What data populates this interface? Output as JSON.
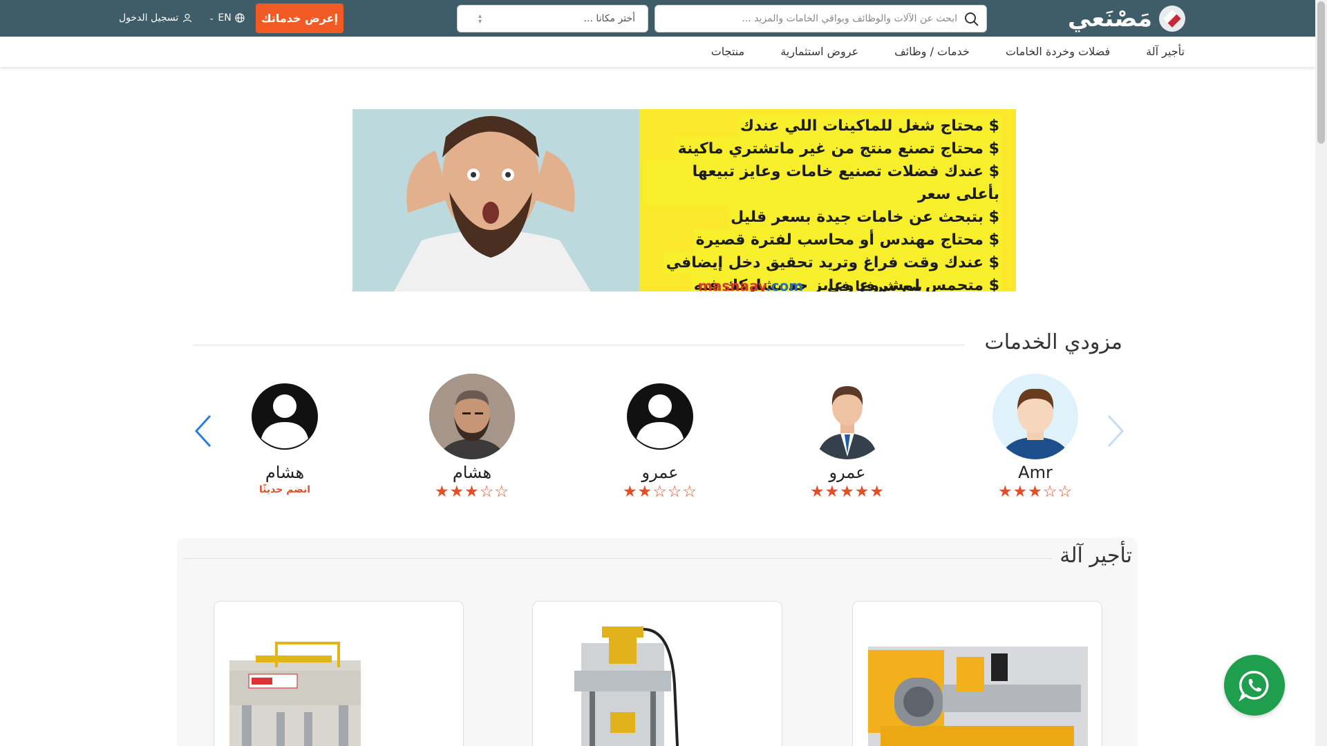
{
  "header": {
    "logo_text": "مَصْنَعي",
    "search_placeholder": "ابحث عن الآلات والوظائف وبواقي الخامات والمزيد ...",
    "place_placeholder": "أختر مكانا ...",
    "cta_label": "إعرض خدماتك",
    "lang_label": "EN",
    "login_label": "تسجيل الدخول"
  },
  "nav": {
    "items": [
      "تأجير آلة",
      "فضلات وخردة الخامات",
      "خدمات / وظائف",
      "عروض استثمارية",
      "منتجات"
    ]
  },
  "banner": {
    "lines": [
      "$ محتاج شغل للماكينات اللي عندك",
      "$ محتاج تصنع منتج من غير ماتشتري ماكينة",
      "$ عندك فضلات تصنيع خامات وعايز تبيعها بأعلى سعر",
      "$ بتبحث عن خامات جيدة بسعر قليل",
      "$ محتاج مهندس أو محاسب لفترة قصيرة",
      "$ عندك وقت فراغ وتريد تحقيق دخل إيضافي",
      "$ متحمس لمشروع وعايز حد يشاركك فيه"
    ],
    "url_prefix": "masnaay",
    "url_suffix": ".com",
    "url_trailing": "بيع شرفنا في"
  },
  "providers": {
    "title": "مزودي الخدمات",
    "items": [
      {
        "name": "Amr",
        "stars": "★★★☆☆",
        "rating": 3,
        "avatar": "cartoon-man"
      },
      {
        "name": "عمرو",
        "stars": "★★★★★",
        "rating": 5,
        "avatar": "businessman"
      },
      {
        "name": "عمرو",
        "stars": "★★☆☆☆",
        "rating": 2,
        "avatar": "default"
      },
      {
        "name": "هشام",
        "stars": "★★★☆☆",
        "rating": 3,
        "avatar": "photo"
      },
      {
        "name": "هشام",
        "newtag": "انضم حديثًا",
        "avatar": "default"
      }
    ]
  },
  "rentals": {
    "title": "تأجير آلة"
  },
  "colors": {
    "topbar": "#3e5d69",
    "accent": "#f15a22",
    "star": "#e44d26",
    "whatsapp": "#1f9e4e"
  }
}
